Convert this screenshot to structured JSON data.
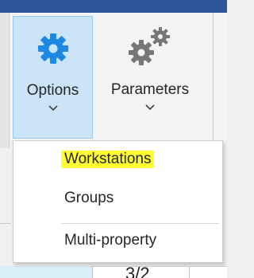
{
  "ribbon": {
    "options_label": "Options",
    "parameters_label": "Parameters",
    "options_icon": "gear-icon",
    "parameters_icon": "gears-icon",
    "chevron_icon": "chevron-down-icon"
  },
  "menu": {
    "items": [
      {
        "label": "Workstations",
        "highlighted": true
      },
      {
        "label": "Groups"
      },
      {
        "label": "Multi-property"
      }
    ]
  },
  "sheet": {
    "visible_cell_value": "3/2"
  },
  "colors": {
    "accent_blue": "#1e88e5",
    "selected_button_bg": "#cce4f7",
    "highlight_yellow": "#ffff33",
    "gear_gray": "#777777"
  }
}
